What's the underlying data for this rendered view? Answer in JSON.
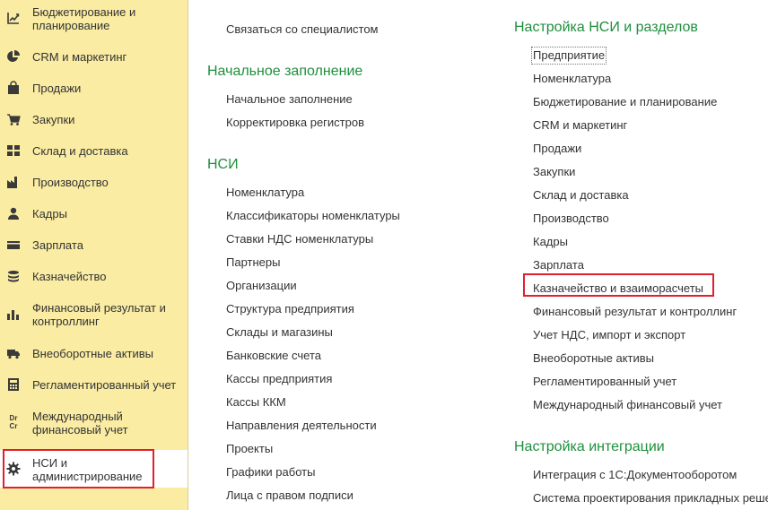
{
  "sidebar": {
    "items": [
      {
        "label_lines": [
          "Бюджетирование и",
          "планирование"
        ],
        "icon": "budget-chart-icon"
      },
      {
        "label_lines": [
          "CRM и маркетинг"
        ],
        "icon": "pie-chart-icon"
      },
      {
        "label_lines": [
          "Продажи"
        ],
        "icon": "shopping-bag-icon"
      },
      {
        "label_lines": [
          "Закупки"
        ],
        "icon": "shopping-cart-icon"
      },
      {
        "label_lines": [
          "Склад и доставка"
        ],
        "icon": "warehouse-grid-icon"
      },
      {
        "label_lines": [
          "Производство"
        ],
        "icon": "factory-icon"
      },
      {
        "label_lines": [
          "Кадры"
        ],
        "icon": "person-icon"
      },
      {
        "label_lines": [
          "Зарплата"
        ],
        "icon": "wallet-icon"
      },
      {
        "label_lines": [
          "Казначейство"
        ],
        "icon": "coins-icon"
      },
      {
        "label_lines": [
          "Финансовый результат и",
          "контроллинг"
        ],
        "icon": "bar-chart-icon"
      },
      {
        "label_lines": [
          "Внеоборотные активы"
        ],
        "icon": "truck-icon"
      },
      {
        "label_lines": [
          "Регламентированный учет"
        ],
        "icon": "calculator-icon"
      },
      {
        "label_lines": [
          "Международный",
          "финансовый учет"
        ],
        "icon": "dr-cr-icon",
        "icon_text": [
          "Dr",
          "Cr"
        ]
      },
      {
        "label_lines": [
          "НСИ и",
          "администрирование"
        ],
        "icon": "gear-icon",
        "active": true
      }
    ]
  },
  "col1": {
    "top_link": "Связаться со специалистом",
    "sections": [
      {
        "title": "Начальное заполнение",
        "links": [
          "Начальное заполнение",
          "Корректировка регистров"
        ]
      },
      {
        "title": "НСИ",
        "links": [
          "Номенклатура",
          "Классификаторы номенклатуры",
          "Ставки НДС номенклатуры",
          "Партнеры",
          "Организации",
          "Структура предприятия",
          "Склады и магазины",
          "Банковские счета",
          "Кассы предприятия",
          "Кассы ККМ",
          "Направления деятельности",
          "Проекты",
          "Графики работы",
          "Лица с правом подписи"
        ]
      }
    ]
  },
  "col2": {
    "sections": [
      {
        "title": "Настройка НСИ и разделов",
        "links": [
          "Предприятие",
          "Номенклатура",
          "Бюджетирование и планирование",
          "CRM и маркетинг",
          "Продажи",
          "Закупки",
          "Склад и доставка",
          "Производство",
          "Кадры",
          "Зарплата",
          "Казначейство и взаиморасчеты",
          "Финансовый результат и контроллинг",
          "Учет НДС, импорт и экспорт",
          "Внеоборотные активы",
          "Регламентированный учет",
          "Международный финансовый учет"
        ]
      },
      {
        "title": "Настройка интеграции",
        "links": [
          "Интеграция с 1С:Документооборотом",
          "Система проектирования прикладных реше"
        ]
      }
    ]
  },
  "colors": {
    "sidebar_bg": "#faeca3",
    "section_title": "#1e8f3c",
    "highlight": "#e0202e",
    "text": "#333333"
  }
}
